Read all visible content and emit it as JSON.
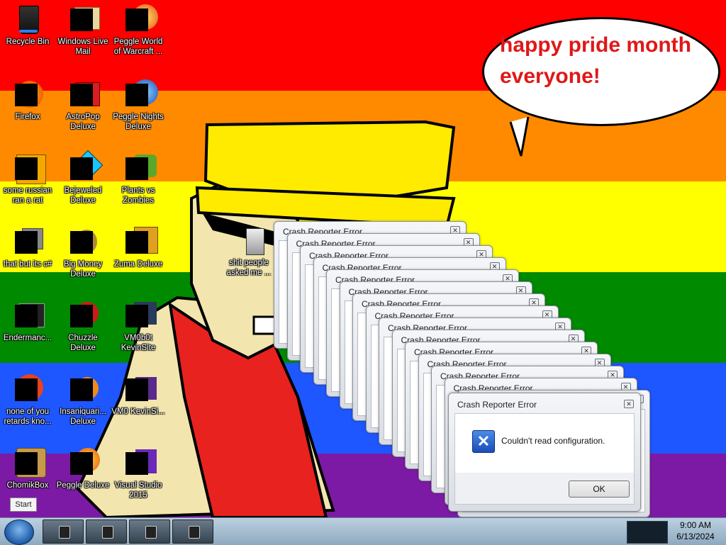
{
  "desktop": {
    "icons": [
      {
        "label": "Recycle Bin"
      },
      {
        "label": "Windows Live Mail"
      },
      {
        "label": "Peggle World of Warcraft ..."
      },
      {
        "label": "Firefox"
      },
      {
        "label": "AstroPop Deluxe"
      },
      {
        "label": "Peggle Nights Deluxe"
      },
      {
        "label": "some russian ran a rat"
      },
      {
        "label": "Bejeweled Deluxe"
      },
      {
        "label": "Plants vs Zombies"
      },
      {
        "label": "that but its c#"
      },
      {
        "label": "Big Money Deluxe"
      },
      {
        "label": "Zuma Deluxe"
      },
      {
        "label": "Endermanc..."
      },
      {
        "label": "Chuzzle Deluxe"
      },
      {
        "label": "VM0b0t KevinSite"
      },
      {
        "label": "none of you retards kno..."
      },
      {
        "label": "Insaniquari... Deluxe"
      },
      {
        "label": "VM0 KevinSi..."
      },
      {
        "label": "ChomikBox"
      },
      {
        "label": "Peggle Deluxe"
      },
      {
        "label": "Visual Studio 2015"
      },
      {
        "label": "shit people asked me ..."
      }
    ],
    "speech_bubble": "happy pride month everyone!",
    "start_tooltip": "Start"
  },
  "dialogs": {
    "stack_title": "Crash Reporter Error",
    "stack_count": 15,
    "main": {
      "title": "Crash Reporter Error",
      "message": "Couldn't read configuration.",
      "ok_label": "OK"
    }
  },
  "taskbar": {
    "buttons": 4,
    "clock_time": "9:00 AM",
    "clock_date": "6/13/2024"
  },
  "colors": {
    "rainbow": [
      "#ff0000",
      "#ff8a00",
      "#ffff00",
      "#008a00",
      "#1e56ff",
      "#7d1aa5"
    ],
    "bubble_text": "#e01818"
  }
}
